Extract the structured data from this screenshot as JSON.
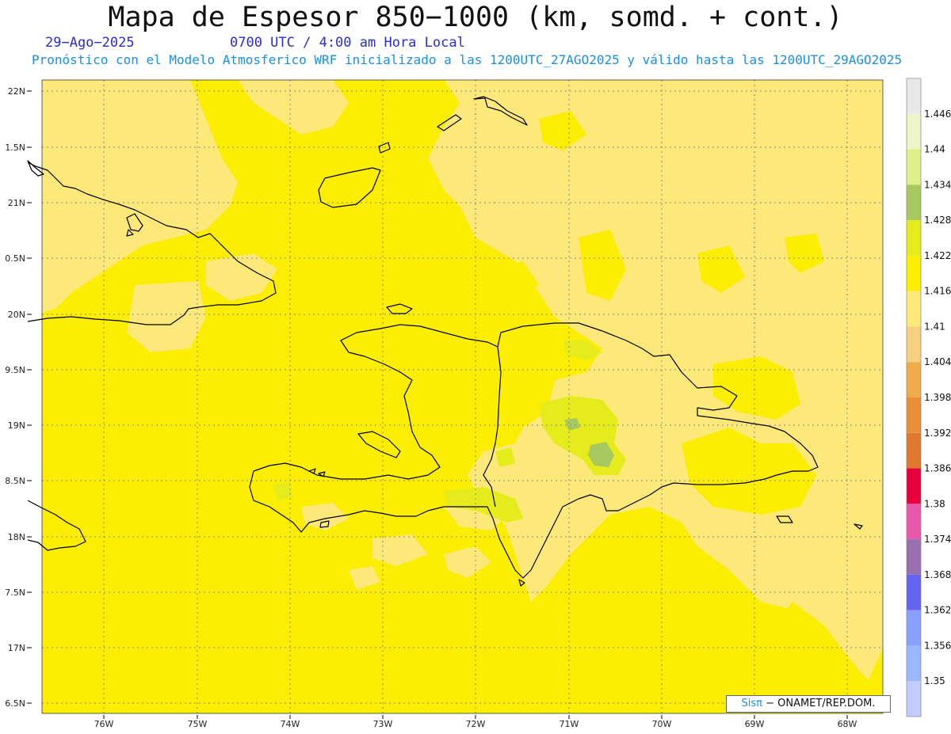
{
  "header": {
    "title": "Mapa de Espesor 850−1000 (km, somd. + cont.)",
    "date": "29−Ago−2025",
    "time": "0700 UTC / 4:00 am Hora Local",
    "forecast": "Pronóstico con el Modelo Atmosferico WRF inicializado a las 1200UTC_27AGO2025 y válido hasta las  1200UTC_29AGO2025"
  },
  "axes": {
    "lat_labels": [
      "22N",
      "1.5N",
      "21N",
      "0.5N",
      "20N",
      "9.5N",
      "19N",
      "8.5N",
      "18N",
      "7.5N",
      "17N",
      "6.5N"
    ],
    "lon_labels": [
      "76W",
      "75W",
      "74W",
      "73W",
      "72W",
      "71W",
      "70W",
      "69W",
      "68W"
    ]
  },
  "colorbar": {
    "labels": [
      "1.446",
      "1.44",
      "1.434",
      "1.428",
      "1.422",
      "1.416",
      "1.41",
      "1.404",
      "1.398",
      "1.392",
      "1.386",
      "1.38",
      "1.374",
      "1.368",
      "1.362",
      "1.356",
      "1.35"
    ],
    "colors": [
      "#e8e8e8",
      "#eef5c8",
      "#dff08a",
      "#a8c860",
      "#e6ec1c",
      "#fbee00",
      "#fde87a",
      "#f5d080",
      "#f0ac48",
      "#e89038",
      "#e07830",
      "#e8003c",
      "#e858a8",
      "#9870b0",
      "#6464f0",
      "#8aa0ff",
      "#9ab8ff",
      "#c2ccff"
    ]
  },
  "map_colors": {
    "level_1416": "#fbee00",
    "level_1410": "#fde87a",
    "level_1422": "#e6ec1c",
    "level_1428": "#a8c860",
    "coast": "#000000",
    "grid": "#8a8a8a"
  },
  "credit": {
    "brand": "Sisπ",
    "rest": " − ONAMET/REP.DOM."
  }
}
